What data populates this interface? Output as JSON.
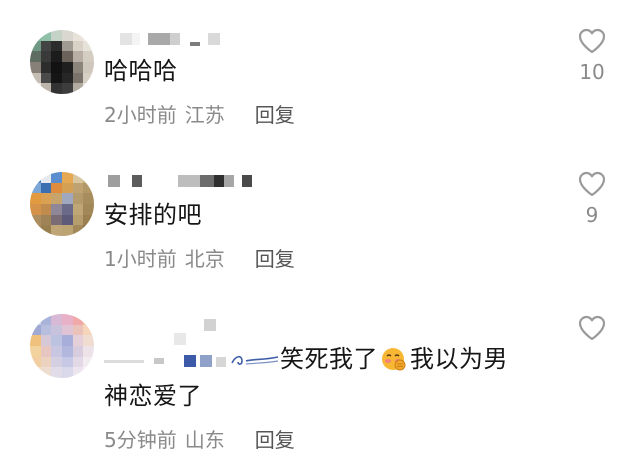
{
  "comments": [
    {
      "text": "哈哈哈",
      "time": "2小时前",
      "location": "江苏",
      "reply_label": "回复",
      "like_count": "10"
    },
    {
      "text": "安排的吧",
      "time": "1小时前",
      "location": "北京",
      "reply_label": "回复",
      "like_count": "9"
    },
    {
      "text_part1": "笑死我了",
      "text_part2": "我以为男",
      "text_line2": "神恋爱了",
      "emoji_icon": "blushing-face-emoji",
      "time": "5分钟前",
      "location": "山东",
      "reply_label": "回复",
      "like_count": ""
    }
  ],
  "colors": {
    "text": "#161616",
    "meta": "#8a8a8a",
    "reply": "#555555",
    "like_icon": "#9a9a9a"
  }
}
